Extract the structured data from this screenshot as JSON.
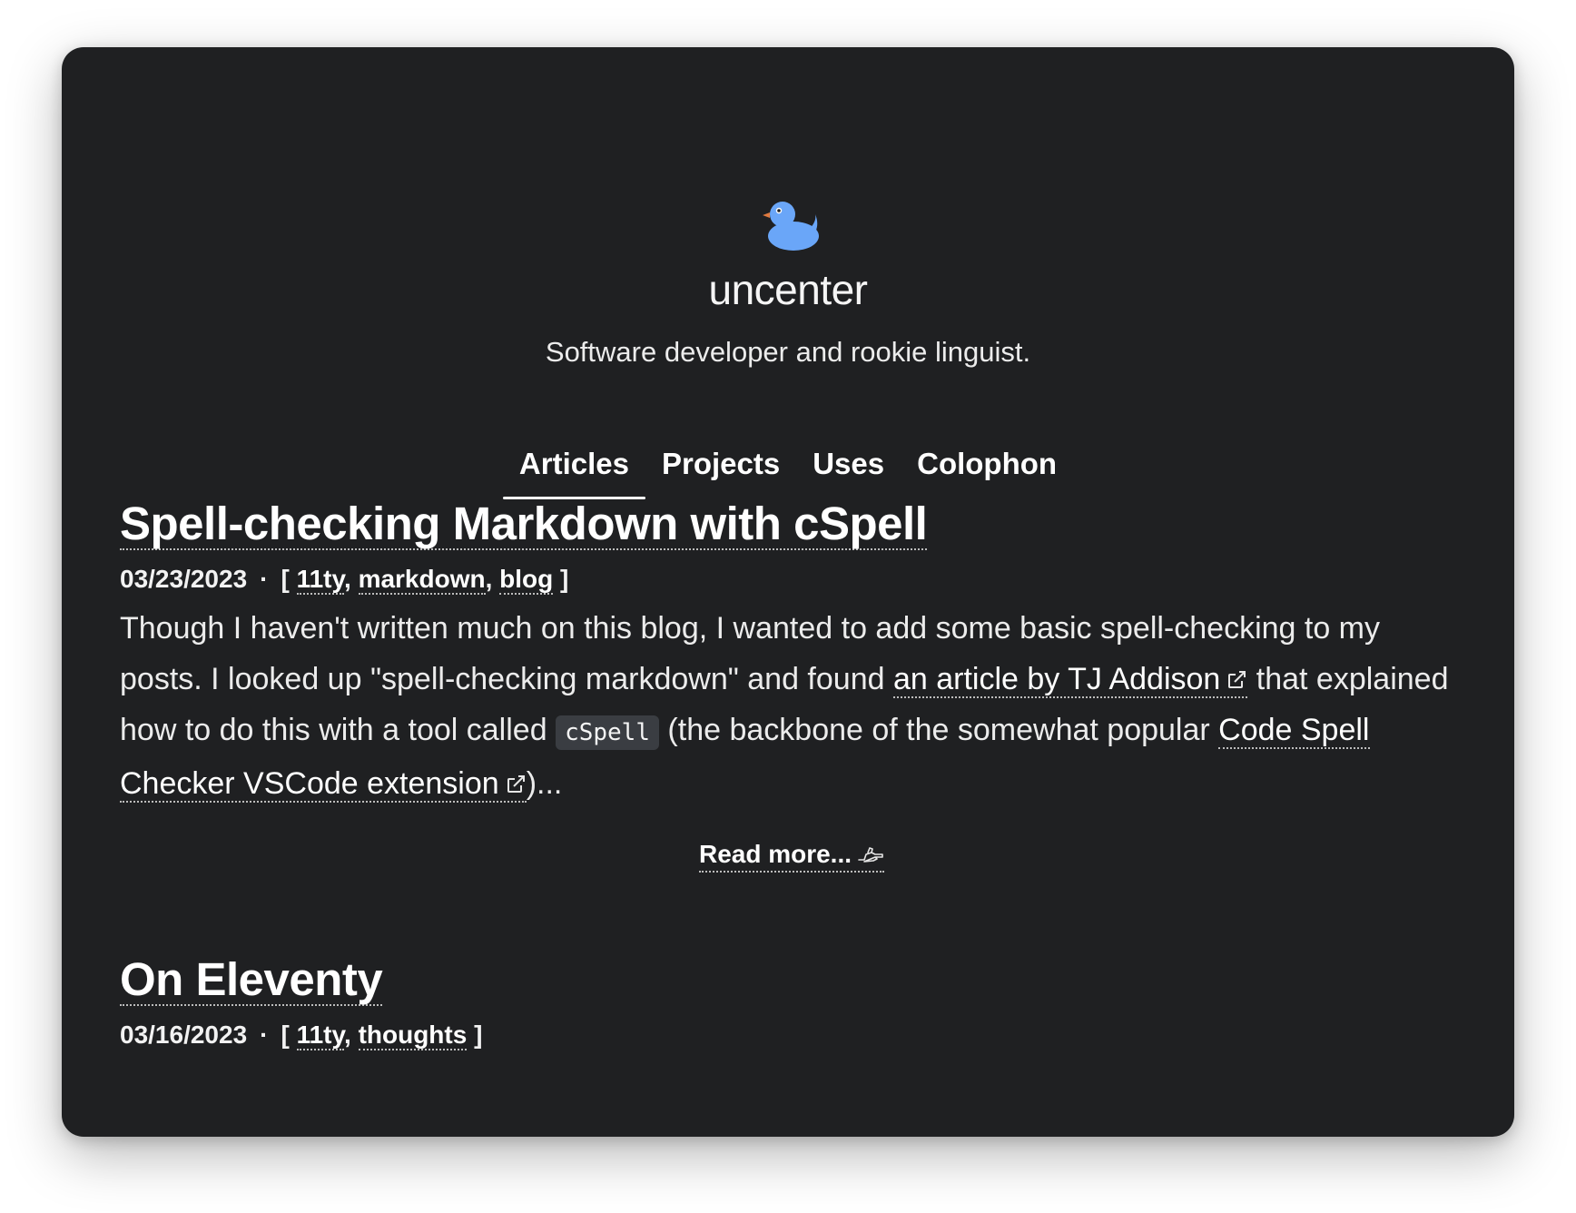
{
  "site": {
    "title": "uncenter",
    "tagline": "Software developer and rookie linguist.",
    "logo_icon": "rubber-duck-icon",
    "logo_color": "#6aa6f8"
  },
  "nav": {
    "items": [
      {
        "label": "Articles",
        "active": true
      },
      {
        "label": "Projects",
        "active": false
      },
      {
        "label": "Uses",
        "active": false
      },
      {
        "label": "Colophon",
        "active": false
      }
    ]
  },
  "articles": [
    {
      "title": "Spell-checking Markdown with cSpell",
      "date": "03/23/2023",
      "separator": "·",
      "bracket_open": "[",
      "bracket_close": "]",
      "tag_sep": ",",
      "tags": [
        "11ty",
        "markdown",
        "blog"
      ],
      "excerpt": {
        "part1": "Though I haven't written much on this blog, I wanted to add some basic spell-checking to my posts. I looked up \"spell-checking markdown\" and found ",
        "link1": "an article by TJ Addison",
        "part2": " that explained how to do this with a tool called ",
        "code": "cSpell",
        "part3": " (the backbone of the somewhat popular ",
        "link2": "Code Spell Checker VSCode extension",
        "part4": ")..."
      },
      "read_more": "Read more...",
      "read_more_icon": "pointing-hand-icon"
    },
    {
      "title": "On Eleventy",
      "date": "03/16/2023",
      "separator": "·",
      "bracket_open": "[",
      "bracket_close": "]",
      "tag_sep": ",",
      "tags": [
        "11ty",
        "thoughts"
      ]
    }
  ]
}
